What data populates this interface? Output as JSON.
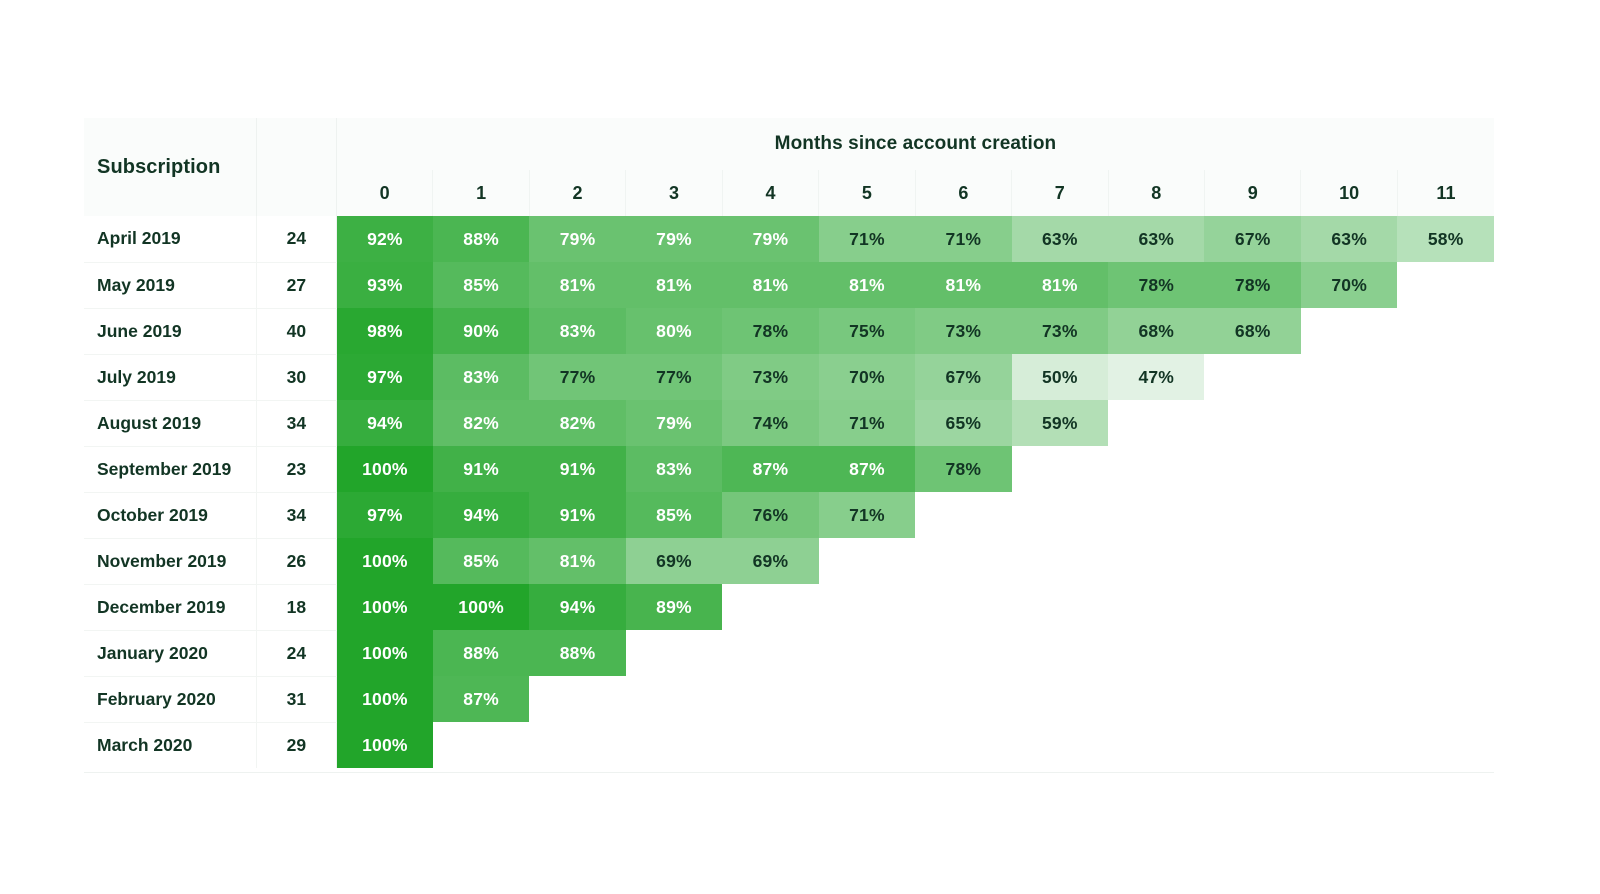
{
  "header": {
    "corner_label": "Subscription",
    "months_title": "Months since account creation",
    "month_columns": [
      "0",
      "1",
      "2",
      "3",
      "4",
      "5",
      "6",
      "7",
      "8",
      "9",
      "10",
      "11"
    ]
  },
  "colors": {
    "accent_max": "#22a52a",
    "accent_min": "#eff7f1",
    "text_dark": "#123524",
    "text_light": "#ffffff",
    "header_bg": "#fafcfb",
    "page_bg": "#ffffff",
    "grid_line": "#eef2f0"
  },
  "rows": [
    {
      "label": "April 2019",
      "size": "24",
      "values": [
        92,
        88,
        79,
        79,
        79,
        71,
        71,
        63,
        63,
        67,
        63,
        58
      ]
    },
    {
      "label": "May 2019",
      "size": "27",
      "values": [
        93,
        85,
        81,
        81,
        81,
        81,
        81,
        81,
        78,
        78,
        70,
        null
      ]
    },
    {
      "label": "June 2019",
      "size": "40",
      "values": [
        98,
        90,
        83,
        80,
        78,
        75,
        73,
        73,
        68,
        68,
        null,
        null
      ]
    },
    {
      "label": "July 2019",
      "size": "30",
      "values": [
        97,
        83,
        77,
        77,
        73,
        70,
        67,
        50,
        47,
        null,
        null,
        null
      ]
    },
    {
      "label": "August 2019",
      "size": "34",
      "values": [
        94,
        82,
        82,
        79,
        74,
        71,
        65,
        59,
        null,
        null,
        null,
        null
      ]
    },
    {
      "label": "September 2019",
      "size": "23",
      "values": [
        100,
        91,
        91,
        83,
        87,
        87,
        78,
        null,
        null,
        null,
        null,
        null
      ]
    },
    {
      "label": "October 2019",
      "size": "34",
      "values": [
        97,
        94,
        91,
        85,
        76,
        71,
        null,
        null,
        null,
        null,
        null,
        null
      ]
    },
    {
      "label": "November 2019",
      "size": "26",
      "values": [
        100,
        85,
        81,
        69,
        69,
        null,
        null,
        null,
        null,
        null,
        null,
        null
      ]
    },
    {
      "label": "December 2019",
      "size": "18",
      "values": [
        100,
        100,
        94,
        89,
        null,
        null,
        null,
        null,
        null,
        null,
        null,
        null
      ]
    },
    {
      "label": "January 2020",
      "size": "24",
      "values": [
        100,
        88,
        88,
        null,
        null,
        null,
        null,
        null,
        null,
        null,
        null,
        null
      ]
    },
    {
      "label": "February 2020",
      "size": "31",
      "values": [
        100,
        87,
        null,
        null,
        null,
        null,
        null,
        null,
        null,
        null,
        null,
        null
      ]
    },
    {
      "label": "March 2020",
      "size": "29",
      "values": [
        100,
        null,
        null,
        null,
        null,
        null,
        null,
        null,
        null,
        null,
        null,
        null
      ]
    }
  ],
  "chart_data": {
    "type": "heatmap",
    "title": "Months since account creation",
    "xlabel": "Months since account creation",
    "ylabel": "Subscription",
    "x": [
      "0",
      "1",
      "2",
      "3",
      "4",
      "5",
      "6",
      "7",
      "8",
      "9",
      "10",
      "11"
    ],
    "y": [
      "April 2019",
      "May 2019",
      "June 2019",
      "July 2019",
      "August 2019",
      "September 2019",
      "October 2019",
      "November 2019",
      "December 2019",
      "January 2020",
      "February 2020",
      "March 2020"
    ],
    "cohort_sizes": [
      24,
      27,
      40,
      30,
      34,
      23,
      34,
      26,
      18,
      24,
      31,
      29
    ],
    "unit": "percent",
    "value_range": [
      47,
      100
    ],
    "grid": false,
    "legend": "none",
    "values": [
      [
        92,
        88,
        79,
        79,
        79,
        71,
        71,
        63,
        63,
        67,
        63,
        58
      ],
      [
        93,
        85,
        81,
        81,
        81,
        81,
        81,
        81,
        78,
        78,
        70,
        null
      ],
      [
        98,
        90,
        83,
        80,
        78,
        75,
        73,
        73,
        68,
        68,
        null,
        null
      ],
      [
        97,
        83,
        77,
        77,
        73,
        70,
        67,
        50,
        47,
        null,
        null,
        null
      ],
      [
        94,
        82,
        82,
        79,
        74,
        71,
        65,
        59,
        null,
        null,
        null,
        null
      ],
      [
        100,
        91,
        91,
        83,
        87,
        87,
        78,
        null,
        null,
        null,
        null,
        null
      ],
      [
        97,
        94,
        91,
        85,
        76,
        71,
        null,
        null,
        null,
        null,
        null,
        null
      ],
      [
        100,
        85,
        81,
        69,
        69,
        null,
        null,
        null,
        null,
        null,
        null,
        null
      ],
      [
        100,
        100,
        94,
        89,
        null,
        null,
        null,
        null,
        null,
        null,
        null,
        null
      ],
      [
        100,
        88,
        88,
        null,
        null,
        null,
        null,
        null,
        null,
        null,
        null,
        null
      ],
      [
        100,
        87,
        null,
        null,
        null,
        null,
        null,
        null,
        null,
        null,
        null,
        null
      ],
      [
        100,
        null,
        null,
        null,
        null,
        null,
        null,
        null,
        null,
        null,
        null,
        null
      ]
    ]
  }
}
